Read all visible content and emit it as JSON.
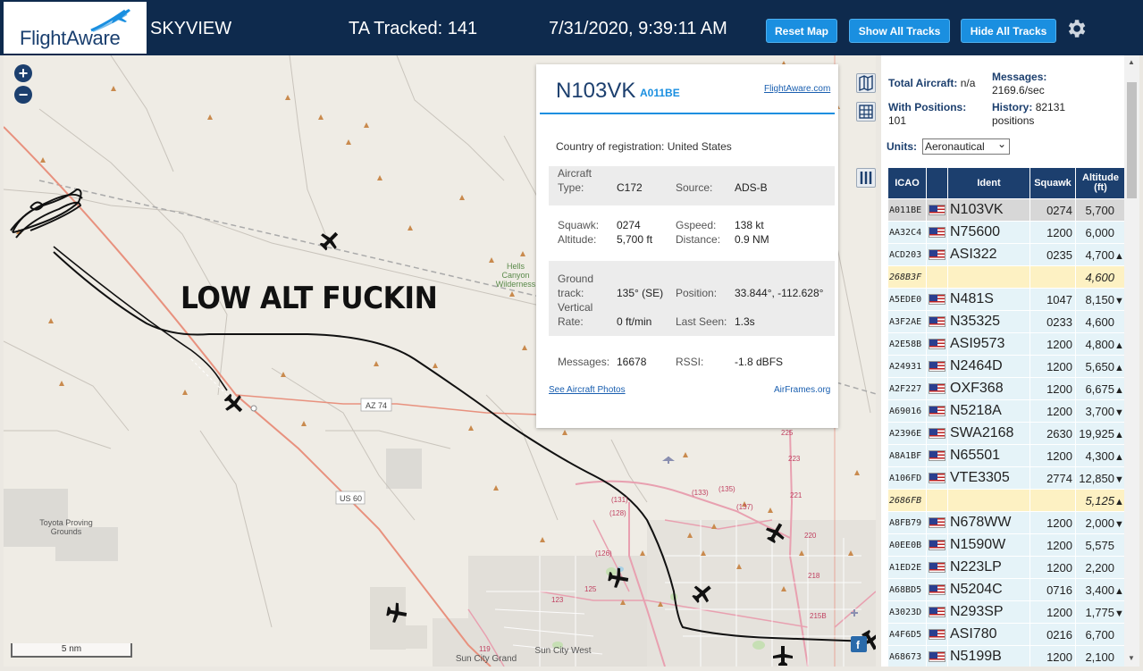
{
  "header": {
    "logo": "FlightAware",
    "app_name": "SKYVIEW",
    "tracked": "TA Tracked: 141",
    "datetime": "7/31/2020, 9:39:11 AM",
    "buttons": {
      "reset": "Reset Map",
      "show_all": "Show All Tracks",
      "hide_all": "Hide All Tracks"
    },
    "settings_icon": "gear-icon"
  },
  "map": {
    "zoom_in": "+",
    "zoom_out": "−",
    "scale": "5 nm",
    "overlay_text": "LOW ALT FUCKIN",
    "labels": {
      "hells_canyon": "Hells Canyon Wilderness",
      "az74": "AZ 74",
      "us60": "US 60",
      "toyota": "Toyota Proving Grounds",
      "sun_city_grand": "Sun City Grand",
      "sun_city_west": "Sun City West"
    }
  },
  "popup": {
    "ident": "N103VK",
    "hex": "A011BE",
    "flightaware_link": "FlightAware.com",
    "country_label": "Country of registration:",
    "country_value": "United States",
    "aircraft_type_label": "Aircraft Type:",
    "aircraft_type": "C172",
    "source_label": "Source:",
    "source": "ADS-B",
    "squawk_label": "Squawk:",
    "squawk": "0274",
    "gspeed_label": "Gspeed:",
    "gspeed": "138 kt",
    "altitude_label": "Altitude:",
    "altitude": "5,700 ft",
    "distance_label": "Distance:",
    "distance": "0.9 NM",
    "ground_track_label": "Ground track:",
    "ground_track": "135° (SE)",
    "position_label": "Position:",
    "position": "33.844°, -112.628°",
    "vertical_rate_label": "Vertical Rate:",
    "vertical_rate": "0 ft/min",
    "last_seen_label": "Last Seen:",
    "last_seen": "1.3s",
    "messages_label": "Messages:",
    "messages": "16678",
    "rssi_label": "RSSI:",
    "rssi": "-1.8 dBFS",
    "photos_link": "See Aircraft Photos",
    "airframes_link": "AirFrames.org"
  },
  "panel": {
    "total_aircraft_label": "Total Aircraft:",
    "total_aircraft": "n/a",
    "with_positions_label": "With Positions:",
    "with_positions": "101",
    "messages_label": "Messages:",
    "messages": "2169.6/sec",
    "history_label": "History:",
    "history": "82131 positions",
    "units_label": "Units:",
    "units_value": "Aeronautical",
    "columns": [
      "ICAO",
      "",
      "Ident",
      "Squawk",
      "Altitude (ft)"
    ],
    "rows": [
      {
        "icao": "A011BE",
        "flag": true,
        "ident": "N103VK",
        "squawk": "0274",
        "alt": "5,700",
        "vr": "",
        "state": "sel"
      },
      {
        "icao": "AA32C4",
        "flag": true,
        "ident": "N75600",
        "squawk": "1200",
        "alt": "6,000",
        "vr": "",
        "state": ""
      },
      {
        "icao": "ACD203",
        "flag": true,
        "ident": "ASI322",
        "squawk": "0235",
        "alt": "4,700",
        "vr": "▲",
        "state": ""
      },
      {
        "icao": "268B3F",
        "flag": false,
        "ident": "",
        "squawk": "",
        "alt": "4,600",
        "vr": "",
        "state": "nopos"
      },
      {
        "icao": "A5EDE0",
        "flag": true,
        "ident": "N481S",
        "squawk": "1047",
        "alt": "8,150",
        "vr": "▼",
        "state": ""
      },
      {
        "icao": "A3F2AE",
        "flag": true,
        "ident": "N35325",
        "squawk": "0233",
        "alt": "4,600",
        "vr": "",
        "state": ""
      },
      {
        "icao": "A2E58B",
        "flag": true,
        "ident": "ASI9573",
        "squawk": "1200",
        "alt": "4,800",
        "vr": "▲",
        "state": ""
      },
      {
        "icao": "A24931",
        "flag": true,
        "ident": "N2464D",
        "squawk": "1200",
        "alt": "5,650",
        "vr": "▲",
        "state": ""
      },
      {
        "icao": "A2F227",
        "flag": true,
        "ident": "OXF368",
        "squawk": "1200",
        "alt": "6,675",
        "vr": "▲",
        "state": ""
      },
      {
        "icao": "A69016",
        "flag": true,
        "ident": "N5218A",
        "squawk": "1200",
        "alt": "3,700",
        "vr": "▼",
        "state": ""
      },
      {
        "icao": "A2396E",
        "flag": true,
        "ident": "SWA2168",
        "squawk": "2630",
        "alt": "19,925",
        "vr": "▲",
        "state": ""
      },
      {
        "icao": "A8A1BF",
        "flag": true,
        "ident": "N65501",
        "squawk": "1200",
        "alt": "4,300",
        "vr": "▲",
        "state": ""
      },
      {
        "icao": "A106FD",
        "flag": true,
        "ident": "VTE3305",
        "squawk": "2774",
        "alt": "12,850",
        "vr": "▼",
        "state": ""
      },
      {
        "icao": "2686FB",
        "flag": false,
        "ident": "",
        "squawk": "",
        "alt": "5,125",
        "vr": "▲",
        "state": "nopos"
      },
      {
        "icao": "A8FB79",
        "flag": true,
        "ident": "N678WW",
        "squawk": "1200",
        "alt": "2,000",
        "vr": "▼",
        "state": ""
      },
      {
        "icao": "A0EE0B",
        "flag": true,
        "ident": "N1590W",
        "squawk": "1200",
        "alt": "5,575",
        "vr": "",
        "state": ""
      },
      {
        "icao": "A1ED2E",
        "flag": true,
        "ident": "N223LP",
        "squawk": "1200",
        "alt": "2,200",
        "vr": "",
        "state": ""
      },
      {
        "icao": "A68BD5",
        "flag": true,
        "ident": "N5204C",
        "squawk": "0716",
        "alt": "3,400",
        "vr": "▲",
        "state": ""
      },
      {
        "icao": "A3023D",
        "flag": true,
        "ident": "N293SP",
        "squawk": "1200",
        "alt": "1,775",
        "vr": "▼",
        "state": ""
      },
      {
        "icao": "A4F6D5",
        "flag": true,
        "ident": "ASI780",
        "squawk": "0216",
        "alt": "6,700",
        "vr": "",
        "state": ""
      },
      {
        "icao": "A68673",
        "flag": true,
        "ident": "N5199B",
        "squawk": "1200",
        "alt": "2,100",
        "vr": "",
        "state": ""
      }
    ]
  },
  "colors": {
    "header_bg": "#0e2a4d",
    "accent": "#1a8fe0",
    "table_header": "#1c3f6e",
    "row_bg": "#e5f3f8",
    "selected_row": "#d7d7d7",
    "nopos_row": "#fdf1c3"
  }
}
